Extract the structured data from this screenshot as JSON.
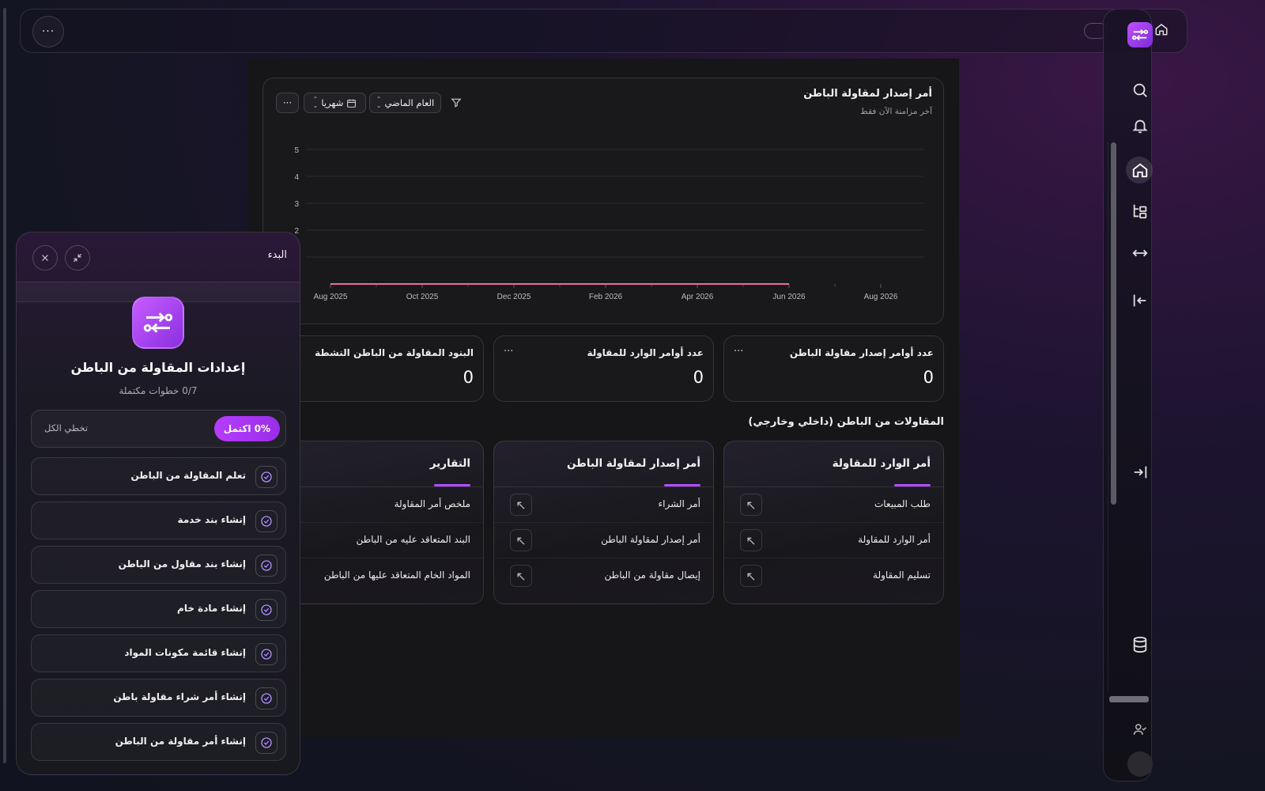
{
  "topbar": {
    "more_label": "···",
    "crumb_separator": "/",
    "tiny_dot": "."
  },
  "rail": {
    "icons": [
      "search-icon",
      "bell-icon",
      "home-icon",
      "tree-icon",
      "arrows-horizontal-icon",
      "collapse-left-icon",
      "logout-icon",
      "database-icon",
      "user-check-icon"
    ]
  },
  "chart_card": {
    "title": "أمر إصدار لمقاولة الباطن",
    "subtitle": "آخر مزامنة الآن فقط",
    "period": "العام الماضي",
    "interval": "شهريا",
    "more_label": "···"
  },
  "chart_data": {
    "type": "line",
    "x": [
      "Aug 2025",
      "Oct 2025",
      "Dec 2025",
      "Feb 2026",
      "Apr 2026",
      "Jun 2026",
      "Aug 2026"
    ],
    "series": [
      {
        "values": [
          0,
          0,
          0,
          0,
          0,
          0
        ]
      }
    ],
    "y_ticks": [
      "5",
      "4",
      "3",
      "2"
    ],
    "ylim": [
      0,
      5
    ],
    "grid": true,
    "line_color": "#f06a9a"
  },
  "stats": [
    {
      "title": "عدد أوامر إصدار مقاولة الباطن",
      "value": "0",
      "more": "···"
    },
    {
      "title": "عدد أوامر الوارد للمقاولة",
      "value": "0",
      "more": "···"
    },
    {
      "title": "البنود المقاولة من الباطن النشطة",
      "value": "0"
    }
  ],
  "section_title": "المقاولات من الباطن (داخلي وخارجي)",
  "link_cards": [
    {
      "title": "أمر الوارد للمقاولة",
      "rows": [
        "طلب المبيعات",
        "أمر الوارد للمقاولة",
        "تسليم المقاولة"
      ]
    },
    {
      "title": "أمر إصدار لمقاولة الباطن",
      "rows": [
        "أمر الشراء",
        "أمر إصدار لمقاولة الباطن",
        "إيصال مقاولة من الباطن"
      ]
    },
    {
      "title": "التقارير",
      "rows": [
        "ملخص أمر المقاولة",
        "البند المتعاقد عليه من الباطن",
        "المواد الخام المتعاقد عليها من الباطن"
      ]
    }
  ],
  "onboarding": {
    "title": "البدء",
    "heading": "إعدادات المقاولة من الباطن",
    "steps_text": "0/7 خطوات مكتملة",
    "progress_label": "0% اكتمل",
    "skip_label": "تخطي الكل",
    "tasks": [
      "تعلم المقاولة من الباطن",
      "إنشاء بند خدمة",
      "إنشاء بند مقاول من الباطن",
      "إنشاء مادة خام",
      "إنشاء قائمة مكونات المواد",
      "إنشاء أمر شراء مقاولة باطن",
      "إنشاء أمر مقاولة من الباطن"
    ]
  },
  "colors": {
    "accent": "#b44cff",
    "chart_line": "#f06a9a"
  }
}
